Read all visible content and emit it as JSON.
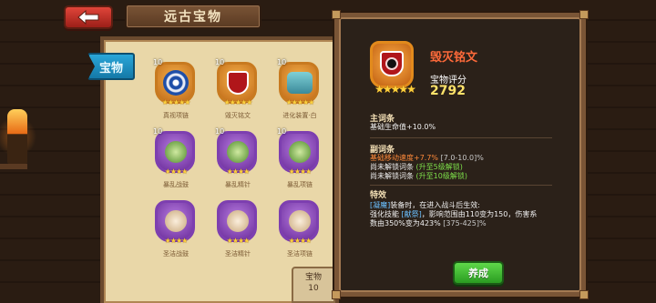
{
  "header": {
    "title": "远古宝物"
  },
  "left_panel": {
    "tab_label": "宝物",
    "items": [
      {
        "level": "10",
        "name": "真视项链",
        "stars": "★★★★★",
        "rarity": "orange"
      },
      {
        "level": "10",
        "name": "毁灭铭文",
        "stars": "★★★★★",
        "rarity": "orange"
      },
      {
        "level": "10",
        "name": "进化装置·白",
        "stars": "★★★★★",
        "rarity": "orange"
      },
      {
        "level": "10",
        "name": "暴乱战鼓",
        "stars": "★★★★",
        "rarity": "purple"
      },
      {
        "level": "10",
        "name": "暴乱精针",
        "stars": "★★★★",
        "rarity": "purple"
      },
      {
        "level": "10",
        "name": "暴乱项链",
        "stars": "★★★★",
        "rarity": "purple"
      },
      {
        "level": "",
        "name": "圣洁战鼓",
        "stars": "★★★★",
        "rarity": "purple"
      },
      {
        "level": "",
        "name": "圣洁精针",
        "stars": "★★★★",
        "rarity": "purple"
      },
      {
        "level": "",
        "name": "圣洁项链",
        "stars": "★★★★",
        "rarity": "purple"
      }
    ],
    "footer_label": "宝物",
    "footer_value": "10"
  },
  "popup": {
    "item_name": "毁灭铭文",
    "stars": "★★★★★",
    "score_label": "宝物评分",
    "score_value": "2792",
    "main_attr_title": "主词条",
    "main_attr_line": "基础生命值+10.0%",
    "sub_attr_title": "副词条",
    "sub_attr_value": "基础移动速度+7.7%",
    "sub_attr_range": "[7.0-10.0]%",
    "locked_1_text": "尚未解锁词条",
    "locked_1_hint": "(升至5级解锁)",
    "locked_2_text": "尚未解锁词条",
    "locked_2_hint": "(升至10级解锁)",
    "effect_title": "特效",
    "effect_tag": "[凝魔]",
    "effect_line1": "装备时，在进入战斗后生效:",
    "effect_line2_prefix": "强化技能",
    "effect_skill": "[献祭]",
    "effect_line2_suffix": "，影响范围由110变为150，伤害系",
    "effect_line3_prefix": "数由350%变为423%",
    "effect_line3_range": "[375-425]%",
    "button_label": "养成"
  },
  "colors": {
    "accent_orange": "#ff6a3a",
    "score_yellow": "#ffe36a",
    "green": "#7de04a",
    "blue": "#6bc0ff",
    "button_green": "#2a9c21"
  }
}
